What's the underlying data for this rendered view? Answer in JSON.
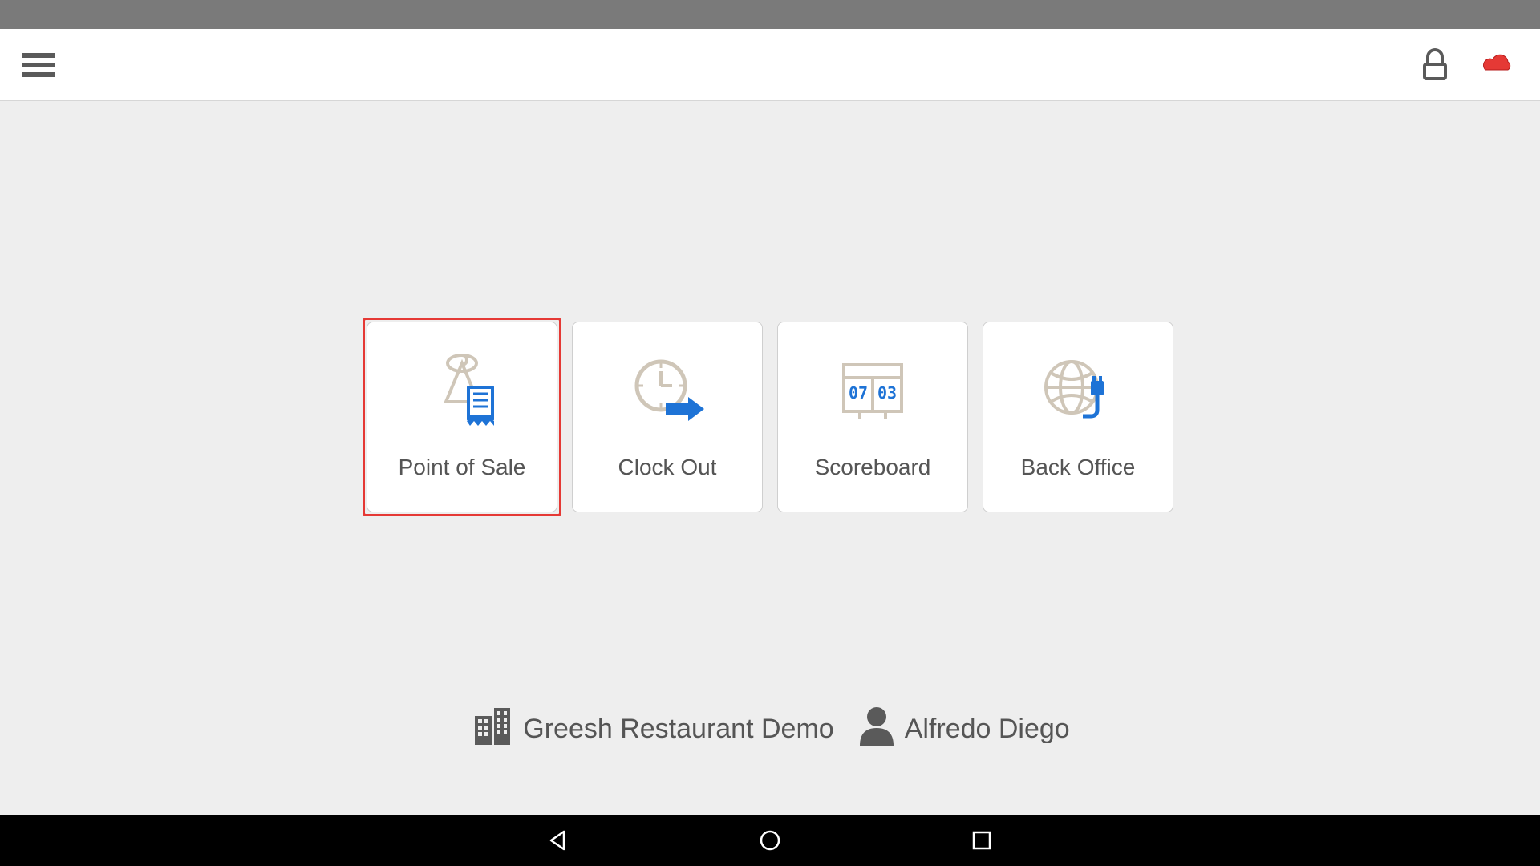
{
  "header": {
    "menu_icon": "hamburger-icon",
    "lock_icon": "lock-icon",
    "cloud_icon": "cloud-icon"
  },
  "tiles": [
    {
      "label": "Point of Sale",
      "icon": "pos-icon",
      "selected": true
    },
    {
      "label": "Clock Out",
      "icon": "clock-out-icon",
      "selected": false
    },
    {
      "label": "Scoreboard",
      "icon": "scoreboard-icon",
      "selected": false
    },
    {
      "label": "Back Office",
      "icon": "back-office-icon",
      "selected": false
    }
  ],
  "scoreboard_digits": {
    "left": "07",
    "right": "03"
  },
  "footer": {
    "business_name": "Greesh Restaurant Demo",
    "user_name": "Alfredo Diego"
  },
  "navbar": {
    "back": "back-button",
    "home": "home-button",
    "recent": "recent-button"
  }
}
